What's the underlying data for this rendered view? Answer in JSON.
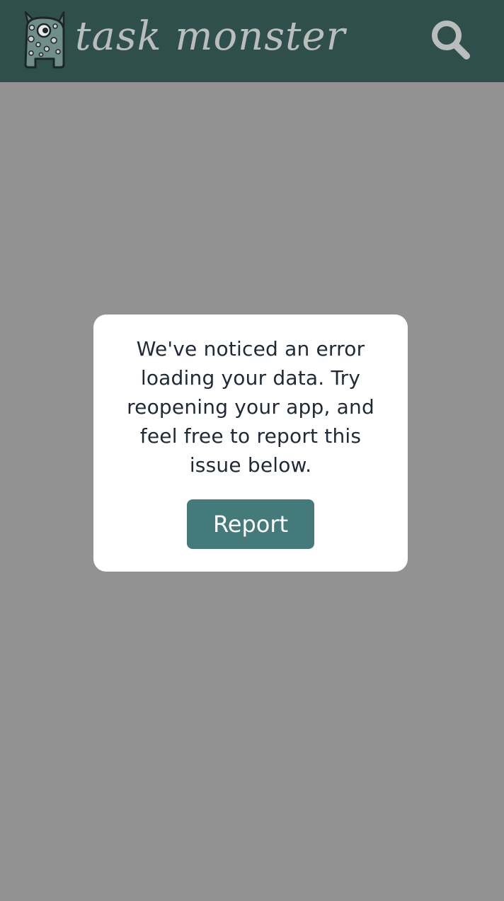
{
  "header": {
    "app_name": "task monster",
    "logo_icon": "monster-mascot-icon",
    "search_icon": "search-icon",
    "background_color": "#2f4f4d",
    "logo_text_color": "#b9bebd"
  },
  "dialog": {
    "message": "We've noticed an error loading your data. Try reopening your app, and feel free to report this issue below.",
    "report_label": "Report",
    "button_color": "#447b7a"
  },
  "overlay_color": "#919291"
}
